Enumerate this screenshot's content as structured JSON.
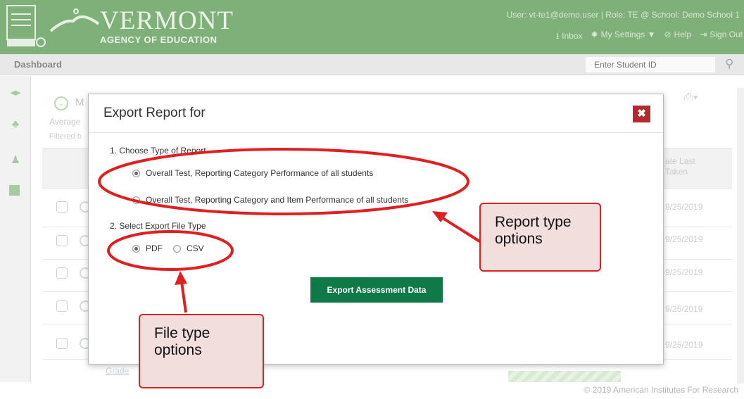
{
  "header": {
    "logo_title": "VERMONT",
    "logo_subtitle": "AGENCY OF EDUCATION",
    "user_info": "User: vt-te1@demo.user  |  Role: TE @ School: Demo School 1",
    "links": [
      {
        "icon": "download-icon",
        "label": "Inbox"
      },
      {
        "icon": "gear-icon",
        "label": "My Settings ▼"
      },
      {
        "icon": "help-icon",
        "label": "Help"
      },
      {
        "icon": "signout-icon",
        "label": "Sign Out"
      }
    ]
  },
  "dashbar": {
    "title": "Dashboard",
    "search_placeholder": "Enter Student ID"
  },
  "background": {
    "m_label": "M",
    "average_label": "Average",
    "filtered_label": "Filtered b",
    "col_header": "ate Last\nTaken",
    "dates": [
      "9/25/2019",
      "9/25/2019",
      "9/25/2019",
      "9/25/2019",
      "9/25/2019"
    ],
    "grade_label": "Grade"
  },
  "modal": {
    "title": "Export Report for",
    "step1": "1.   Choose Type of Report",
    "option1": "Overall Test, Reporting Category Performance of all students",
    "option2": "Overall Test, Reporting Category and Item Performance of all students",
    "step2": "2.   Select Export File Type",
    "file_pdf": "PDF",
    "file_csv": "CSV",
    "export_button": "Export Assessment Data",
    "close": "✖"
  },
  "annotations": {
    "report_callout": "Report type\noptions",
    "file_callout": "File type\noptions",
    "color": "#e02020"
  },
  "footer": "© 2019 American Institutes For Research"
}
